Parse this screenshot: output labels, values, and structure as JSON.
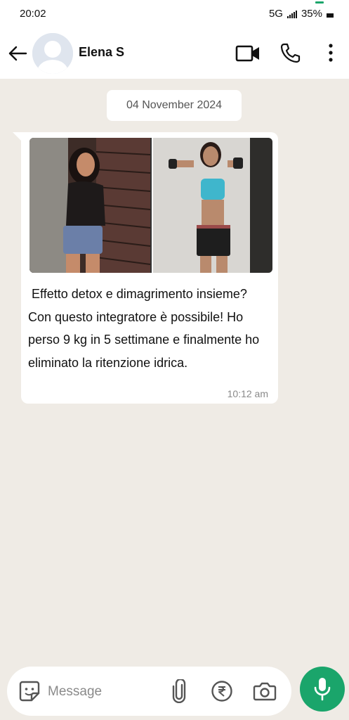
{
  "status_bar": {
    "time": "20:02",
    "network": "5G",
    "battery": "35%"
  },
  "header": {
    "contact_name": "Elena S",
    "icons": [
      "back-arrow-icon",
      "avatar",
      "video-call-icon",
      "phone-icon",
      "more-vert-icon"
    ]
  },
  "chat": {
    "date": "04 November 2024",
    "message": {
      "text": " Effetto detox e dimagrimento insieme? Con questo integratore è possibile! Ho perso 9 kg in 5 settimane e finalmente ho eliminato la ritenzione idrica.",
      "time": "10:12 am"
    }
  },
  "composer": {
    "placeholder": "Message",
    "icons": [
      "sticker-icon",
      "attach-icon",
      "rupee-icon",
      "camera-icon",
      "mic-icon"
    ]
  },
  "colors": {
    "accent": "#1aa56b",
    "chat_background": "#efebe5",
    "bubble": "#ffffff"
  }
}
